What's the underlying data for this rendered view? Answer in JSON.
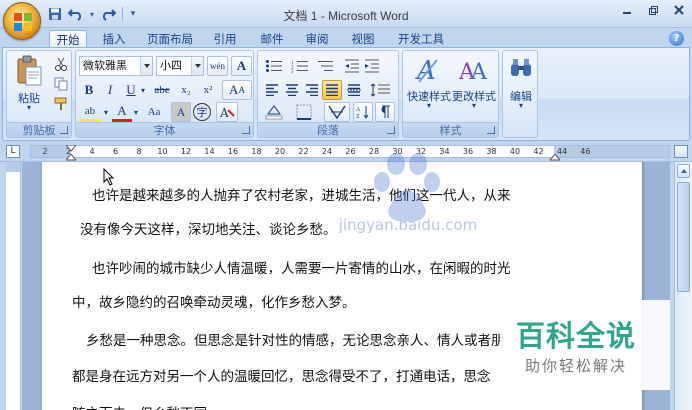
{
  "window": {
    "title": "文档 1 - Microsoft Word",
    "controls": [
      "minimize-icon",
      "restore-icon",
      "close-icon"
    ]
  },
  "quick_access": [
    "save-icon",
    "undo-icon",
    "redo-icon",
    "customize-icon"
  ],
  "tabs": [
    {
      "label": "开始",
      "active": true
    },
    {
      "label": "插入",
      "active": false
    },
    {
      "label": "页面布局",
      "active": false
    },
    {
      "label": "引用",
      "active": false
    },
    {
      "label": "邮件",
      "active": false
    },
    {
      "label": "审阅",
      "active": false
    },
    {
      "label": "视图",
      "active": false
    },
    {
      "label": "开发工具",
      "active": false
    }
  ],
  "ribbon": {
    "clipboard": {
      "label": "剪贴板",
      "paste_label": "粘贴"
    },
    "font": {
      "label": "字体",
      "font_name": "微软雅黑",
      "font_size": "小四",
      "size_up": "A",
      "size_down": "A",
      "clear": "A",
      "phonetic": "wén",
      "bold": "B",
      "italic": "I",
      "underline": "U",
      "strike": "abe",
      "subscript": "x₂",
      "superscript": "x²",
      "highlight": "ab",
      "font_color": "A",
      "change_case": "Aa",
      "shade": "A",
      "enclose": "字"
    },
    "paragraph": {
      "label": "段落"
    },
    "styles": {
      "label": "样式",
      "quick_styles": "快速样式",
      "change_styles": "更改样式"
    },
    "editing": {
      "label": "编辑"
    }
  },
  "ruler": {
    "ticks": [
      "2",
      "2",
      "4",
      "6",
      "8",
      "10",
      "12",
      "14",
      "16",
      "18",
      "20",
      "22",
      "24",
      "26",
      "28",
      "30",
      "32",
      "34",
      "36",
      "38",
      "40",
      "42",
      "44",
      "46"
    ]
  },
  "document": {
    "paragraphs": [
      "也许是越来越多的人抛弃了农村老家，进城生活，他们这一代人，从来",
      "没有像今天这样，深切地关注、谈论乡愁。",
      "也许吵闹的城市缺少人情温暖，人需要一片寄情的山水，在闲暇的时光",
      "中，故乡隐约的召唤牵动灵魂，化作乡愁入梦。",
      "乡愁是一种思念。但思念是针对性的情感，无论思念亲人、情人或者朋",
      "都是身在远方对另一个人的温暖回忆，思念得受不了，打通电话，思念",
      "随之而去，但乡愁不同。"
    ]
  },
  "watermark": {
    "center_text": "jingyan.baidu.com",
    "badge_title": "百科全说",
    "badge_subtitle": "助你轻松解决"
  }
}
